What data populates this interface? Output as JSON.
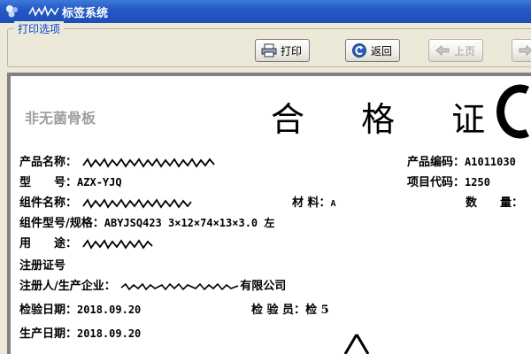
{
  "window": {
    "title": "标签系统",
    "colors": {
      "titlebar": "#2458c6",
      "group_label": "#0046d5",
      "disabled": "#a0a0a0"
    }
  },
  "group": {
    "label": "打印选项"
  },
  "toolbar": {
    "print_label": "打印",
    "back_label": "返回",
    "prev_label": "上页",
    "print_icon": "printer-icon",
    "back_icon": "return-icon",
    "prev_icon": "arrow-left-icon",
    "next_icon": "arrow-right-icon"
  },
  "certificate": {
    "sterile_text": "非无菌骨板",
    "title": "合 格 证",
    "product_name_label": "产品名称：",
    "product_code_label": "产品编码：",
    "product_code_value": "A1011030",
    "model_label": "型　　号：",
    "model_value": "AZX-YJQ",
    "project_code_label": "项目代码：",
    "project_code_value": "1250",
    "component_name_label": "组件名称：",
    "material_label": "材 料：",
    "material_value": "A",
    "quantity_label": "数　　量：",
    "spec_label": "组件型号/规格：",
    "spec_value": "ABYJSQ423 3×12×74×13×3.0 左",
    "usage_label": "用　　途：",
    "reg_label": "注册证号",
    "maker_label": "注册人/生产企业：",
    "maker_suffix": "有限公司",
    "inspect_date_label": "检验日期：",
    "inspect_date_value": "2018.09.20",
    "inspector_label": "检 验 员：",
    "inspector_value": "检 5",
    "prod_date_label": "生产日期：",
    "prod_date_value": "2018.09.20"
  }
}
